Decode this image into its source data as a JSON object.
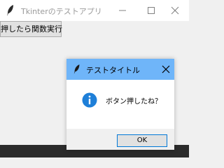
{
  "main_window": {
    "title": "Tkinterのテストアプリ",
    "app_icon": "feather-icon",
    "controls": {
      "minimize": "minimize-icon",
      "maximize": "maximize-icon",
      "close": "close-icon"
    },
    "run_button_label": "押したら関数実行"
  },
  "dialog": {
    "title": "テストタイトル",
    "icon": "feather-icon",
    "close": "close-icon",
    "message_icon": "info-icon",
    "message": "ボタン押したね？",
    "ok_label": "OK",
    "colors": {
      "titlebar": "#6fb5f9",
      "info_icon": "#1e7fd8",
      "ok_border": "#0078d7"
    }
  }
}
